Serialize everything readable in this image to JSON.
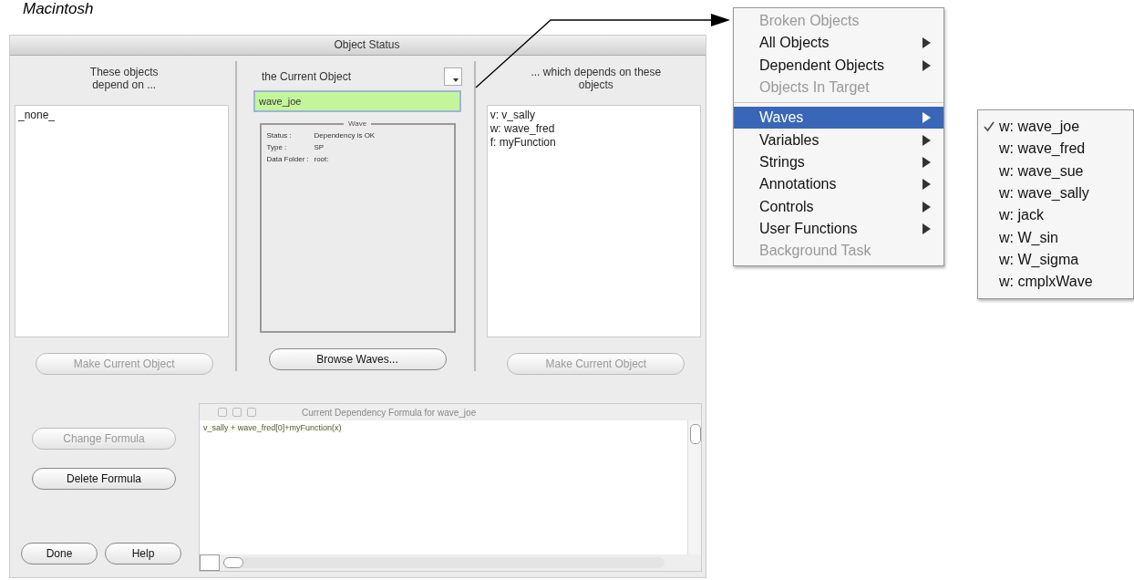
{
  "caption": "Macintosh",
  "dialog": {
    "title": "Object Status",
    "left": {
      "header": "These objects depend on ...",
      "items": [
        "_none_"
      ],
      "button": {
        "label": "Make Current Object",
        "disabled": true
      }
    },
    "center": {
      "header": "the Current Object",
      "field": {
        "value": "wave_joe"
      },
      "group": {
        "title": "Wave",
        "rows": [
          {
            "label": "Status :",
            "value": "Dependency is OK"
          },
          {
            "label": "Type :",
            "value": "SP"
          },
          {
            "label": "Data Folder :",
            "value": "root:"
          }
        ]
      },
      "button": {
        "label": "Browse Waves...",
        "disabled": false
      }
    },
    "right": {
      "header": "... which depends on these objects",
      "items": [
        "v: v_sally",
        "w: wave_fred",
        "f: myFunction"
      ],
      "button": {
        "label": "Make Current Object",
        "disabled": true
      }
    },
    "side_buttons": [
      {
        "label": "Change Formula",
        "disabled": true
      },
      {
        "label": "Delete Formula",
        "disabled": false
      }
    ],
    "bottom_buttons": [
      {
        "label": "Done",
        "disabled": false
      },
      {
        "label": "Help",
        "disabled": false
      }
    ],
    "formula_window": {
      "title": "Current Dependency Formula for wave_joe",
      "text": "v_sally + wave_fred[0]+myFunction(x)"
    }
  },
  "menu": {
    "items": [
      {
        "label": "Broken Objects",
        "disabled": true,
        "selected": false,
        "submenu": false
      },
      {
        "label": "All Objects",
        "disabled": false,
        "selected": false,
        "submenu": true
      },
      {
        "label": "Dependent Objects",
        "disabled": false,
        "selected": false,
        "submenu": true
      },
      {
        "label": "Objects In Target",
        "disabled": true,
        "selected": false,
        "submenu": false,
        "separator_after": true
      },
      {
        "label": "Waves",
        "disabled": false,
        "selected": true,
        "submenu": true
      },
      {
        "label": "Variables",
        "disabled": false,
        "selected": false,
        "submenu": true
      },
      {
        "label": "Strings",
        "disabled": false,
        "selected": false,
        "submenu": true
      },
      {
        "label": "Annotations",
        "disabled": false,
        "selected": false,
        "submenu": true
      },
      {
        "label": "Controls",
        "disabled": false,
        "selected": false,
        "submenu": true
      },
      {
        "label": "User Functions",
        "disabled": false,
        "selected": false,
        "submenu": true
      },
      {
        "label": "Background Task",
        "disabled": true,
        "selected": false,
        "submenu": false
      }
    ],
    "submenu": [
      {
        "label": "w: wave_joe",
        "checked": true
      },
      {
        "label": "w: wave_fred",
        "checked": false
      },
      {
        "label": "w: wave_sue",
        "checked": false
      },
      {
        "label": "w: wave_sally",
        "checked": false
      },
      {
        "label": "w: jack",
        "checked": false
      },
      {
        "label": "w: W_sin",
        "checked": false
      },
      {
        "label": "w: W_sigma",
        "checked": false
      },
      {
        "label": "w: cmplxWave",
        "checked": false
      }
    ]
  }
}
